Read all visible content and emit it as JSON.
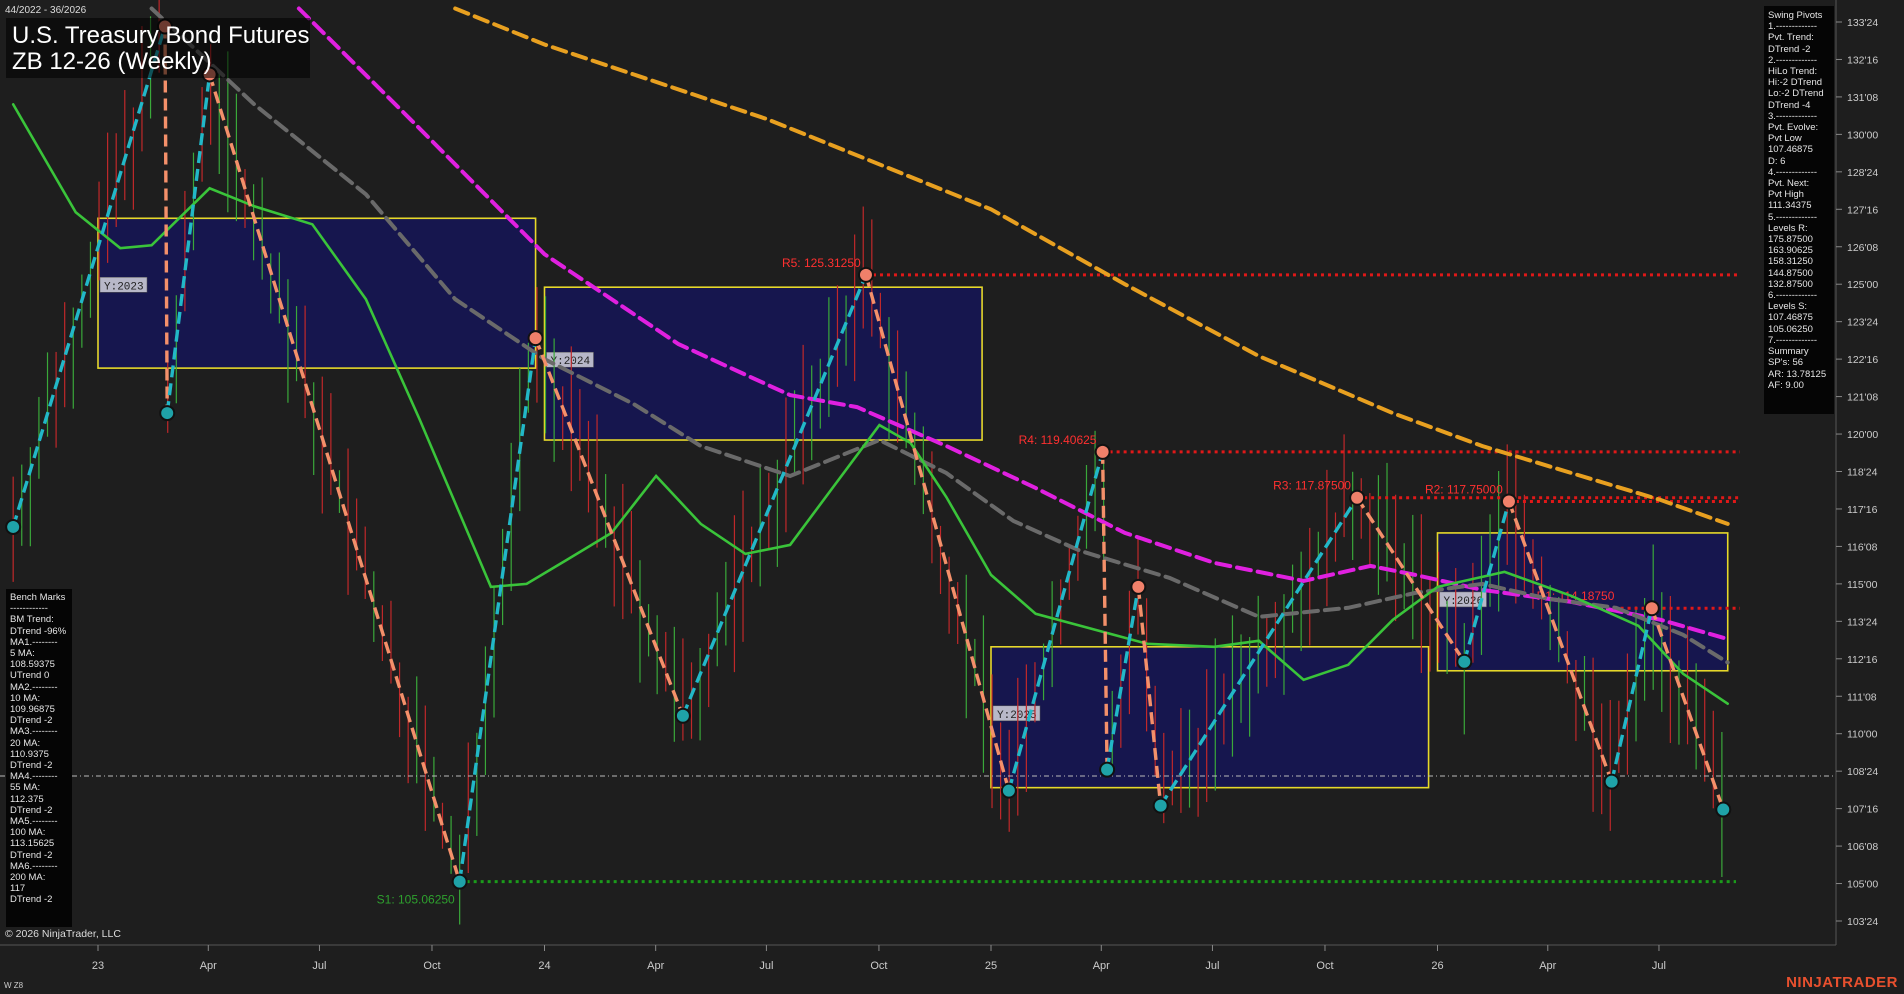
{
  "header": {
    "date_range": "44/2022 - 36/2026",
    "title": "U.S. Treasury Bond Futures",
    "subtitle": "ZB 12-26 (Weekly)"
  },
  "swing_pivots": [
    "Swing Pivots",
    "1.-------------",
    "Pvt. Trend:",
    "DTrend -2",
    "2.-------------",
    "HiLo Trend:",
    "Hi:-2 DTrend",
    "Lo:-2 DTrend",
    "DTrend -4",
    "3.-------------",
    "Pvt. Evolve:",
    "Pvt Low",
    "107.46875",
    "D: 6",
    "4.-------------",
    "Pvt. Next:",
    "Pvt High",
    "111.34375",
    "5.-------------",
    "Levels R:",
    "175.87500",
    "163.90625",
    "158.31250",
    "144.87500",
    "132.87500",
    "6.-------------",
    "Levels S:",
    "107.46875",
    "105.06250",
    "7.-------------",
    "Summary",
    "SP's: 56",
    "AR: 13.78125",
    "AF: 9.00"
  ],
  "bench_marks": [
    "Bench Marks",
    "------------",
    "BM Trend:",
    "DTrend -96%",
    "MA1.--------",
    "5 MA:",
    "108.59375",
    "UTrend 0",
    "MA2.--------",
    "10 MA:",
    "109.96875",
    "DTrend -2",
    "MA3.--------",
    "20 MA:",
    "110.9375",
    "DTrend -2",
    "MA4.--------",
    "55 MA:",
    "112.375",
    "DTrend -2",
    "MA5.--------",
    "100 MA:",
    "113.15625",
    "DTrend -2",
    "MA6.--------",
    "200 MA:",
    "117",
    "DTrend -2"
  ],
  "footer": {
    "copyright": "© 2026 NinjaTrader, LLC",
    "instrument": "W Z8",
    "brand": "NINJATRADER"
  },
  "chart_data": {
    "type": "line",
    "ylim": [
      102.5,
      134.0
    ],
    "grid": false,
    "yticks": [
      "133'24",
      "132'16",
      "131'08",
      "130'00",
      "128'24",
      "127'16",
      "126'08",
      "125'00",
      "123'24",
      "122'16",
      "121'08",
      "120'00",
      "118'24",
      "117'16",
      "116'08",
      "115'00",
      "113'24",
      "112'16",
      "111'08",
      "110'00",
      "108'24",
      "107'16",
      "106'08",
      "105'00",
      "103'24"
    ],
    "ytick_values": [
      133.75,
      132.5,
      131.25,
      130.0,
      128.75,
      127.5,
      126.25,
      125.0,
      123.75,
      122.5,
      121.25,
      120.0,
      118.75,
      117.5,
      116.25,
      115.0,
      113.75,
      112.5,
      111.25,
      110.0,
      108.75,
      107.5,
      106.25,
      105.0,
      103.75
    ],
    "xticks": [
      {
        "label": "23",
        "t": 0.0
      },
      {
        "label": "Apr",
        "t": 0.247
      },
      {
        "label": "Jul",
        "t": 0.496
      },
      {
        "label": "Oct",
        "t": 0.748
      },
      {
        "label": "24",
        "t": 1.0
      },
      {
        "label": "Apr",
        "t": 1.249
      },
      {
        "label": "Jul",
        "t": 1.497
      },
      {
        "label": "Oct",
        "t": 1.749
      },
      {
        "label": "25",
        "t": 2.0
      },
      {
        "label": "Apr",
        "t": 2.247
      },
      {
        "label": "Jul",
        "t": 2.496
      },
      {
        "label": "Oct",
        "t": 2.748
      },
      {
        "label": "26",
        "t": 3.0
      },
      {
        "label": "Apr",
        "t": 3.247
      },
      {
        "label": "Jul",
        "t": 3.496
      }
    ],
    "x_unit": "years since 2023 start",
    "resistance_levels": [
      {
        "label": "R5: 125.31250",
        "value": 125.3125,
        "start": 1.72
      },
      {
        "label": "R4: 119.40625",
        "value": 119.40625,
        "start": 2.25
      },
      {
        "label": "R3: 117.87500",
        "value": 117.875,
        "start": 2.82
      },
      {
        "label": "R2: 117.75000",
        "value": 117.75,
        "start": 3.16
      },
      {
        "label": "R1: 114.18750",
        "value": 114.1875,
        "start": 3.41
      }
    ],
    "support_levels": [
      {
        "label": "S1: 105.06250",
        "value": 105.0625,
        "start": 0.81
      }
    ],
    "year_boxes": [
      {
        "label": "Y:2023",
        "x0": 0.0,
        "x1": 0.98,
        "y0": 122.2,
        "y1": 127.2
      },
      {
        "label": "Y:2024",
        "x0": 1.0,
        "x1": 1.98,
        "y0": 119.8,
        "y1": 124.9
      },
      {
        "label": "Y:2025",
        "x0": 2.0,
        "x1": 2.98,
        "y0": 108.2,
        "y1": 112.9
      },
      {
        "label": "Y:2026",
        "x0": 3.0,
        "x1": 3.65,
        "y0": 112.1,
        "y1": 116.7
      }
    ],
    "swing_pivots": [
      {
        "t": -0.19,
        "v": 116.9,
        "type": "low"
      },
      {
        "t": 0.15,
        "v": 133.6,
        "type": "high"
      },
      {
        "t": 0.155,
        "v": 120.7,
        "type": "low"
      },
      {
        "t": 0.25,
        "v": 132.0,
        "type": "high"
      },
      {
        "t": 0.81,
        "v": 105.0625,
        "type": "low"
      },
      {
        "t": 0.98,
        "v": 123.2,
        "type": "high"
      },
      {
        "t": 1.31,
        "v": 110.6,
        "type": "low"
      },
      {
        "t": 1.72,
        "v": 125.3125,
        "type": "high"
      },
      {
        "t": 2.04,
        "v": 108.1,
        "type": "low"
      },
      {
        "t": 2.25,
        "v": 119.40625,
        "type": "high"
      },
      {
        "t": 2.26,
        "v": 108.8,
        "type": "low"
      },
      {
        "t": 2.33,
        "v": 114.9,
        "type": "high"
      },
      {
        "t": 2.38,
        "v": 107.6,
        "type": "low"
      },
      {
        "t": 2.82,
        "v": 117.875,
        "type": "high"
      },
      {
        "t": 3.06,
        "v": 112.4,
        "type": "low"
      },
      {
        "t": 3.16,
        "v": 117.75,
        "type": "high"
      },
      {
        "t": 3.39,
        "v": 108.4,
        "type": "low"
      },
      {
        "t": 3.48,
        "v": 114.1875,
        "type": "high"
      },
      {
        "t": 3.64,
        "v": 107.46875,
        "type": "low"
      }
    ],
    "series": [
      {
        "name": "200 MA",
        "color": "#e8a020",
        "points": [
          [
            0.8,
            134.2
          ],
          [
            1.0,
            133.0
          ],
          [
            1.5,
            130.5
          ],
          [
            2.0,
            127.5
          ],
          [
            2.3,
            125.0
          ],
          [
            2.6,
            122.6
          ],
          [
            2.9,
            120.7
          ],
          [
            3.1,
            119.6
          ],
          [
            3.3,
            118.7
          ],
          [
            3.5,
            117.8
          ],
          [
            3.65,
            117.0
          ]
        ]
      },
      {
        "name": "100 MA",
        "color": "#e020e0",
        "points": [
          [
            0.45,
            134.2
          ],
          [
            0.7,
            130.5
          ],
          [
            1.0,
            126.0
          ],
          [
            1.3,
            123.0
          ],
          [
            1.55,
            121.3
          ],
          [
            1.7,
            120.9
          ],
          [
            1.9,
            119.6
          ],
          [
            2.1,
            118.2
          ],
          [
            2.3,
            116.7
          ],
          [
            2.5,
            115.7
          ],
          [
            2.7,
            115.1
          ],
          [
            2.85,
            115.6
          ],
          [
            2.95,
            115.3
          ],
          [
            3.1,
            114.8
          ],
          [
            3.3,
            114.4
          ],
          [
            3.5,
            113.8
          ],
          [
            3.65,
            113.15625
          ]
        ]
      },
      {
        "name": "55 MA",
        "color": "#6a6a6a",
        "points": [
          [
            0.12,
            134.2
          ],
          [
            0.35,
            131.0
          ],
          [
            0.6,
            128.0
          ],
          [
            0.8,
            124.5
          ],
          [
            1.0,
            122.5
          ],
          [
            1.2,
            121.0
          ],
          [
            1.35,
            119.6
          ],
          [
            1.55,
            118.6
          ],
          [
            1.75,
            119.8
          ],
          [
            1.9,
            118.7
          ],
          [
            2.05,
            117.1
          ],
          [
            2.2,
            116.1
          ],
          [
            2.4,
            115.2
          ],
          [
            2.6,
            113.9
          ],
          [
            2.8,
            114.2
          ],
          [
            2.95,
            114.7
          ],
          [
            3.1,
            115.0
          ],
          [
            3.25,
            114.5
          ],
          [
            3.4,
            114.2
          ],
          [
            3.55,
            113.3
          ],
          [
            3.65,
            112.375
          ]
        ]
      },
      {
        "name": "20 MA",
        "color": "#3ac43a",
        "points": [
          [
            -0.19,
            131.0
          ],
          [
            -0.05,
            127.4
          ],
          [
            0.05,
            126.2
          ],
          [
            0.12,
            126.3
          ],
          [
            0.25,
            128.2
          ],
          [
            0.35,
            127.6
          ],
          [
            0.48,
            127.0
          ],
          [
            0.6,
            124.5
          ],
          [
            0.72,
            120.5
          ],
          [
            0.88,
            114.9
          ],
          [
            0.96,
            115.0
          ],
          [
            1.05,
            115.8
          ],
          [
            1.15,
            116.7
          ],
          [
            1.25,
            118.6
          ],
          [
            1.35,
            117.0
          ],
          [
            1.45,
            116.0
          ],
          [
            1.55,
            116.3
          ],
          [
            1.65,
            118.3
          ],
          [
            1.75,
            120.3
          ],
          [
            1.82,
            119.7
          ],
          [
            1.9,
            117.9
          ],
          [
            2.0,
            115.3
          ],
          [
            2.1,
            114.0
          ],
          [
            2.2,
            113.6
          ],
          [
            2.35,
            113.0
          ],
          [
            2.5,
            112.9
          ],
          [
            2.6,
            113.1
          ],
          [
            2.7,
            111.8
          ],
          [
            2.8,
            112.3
          ],
          [
            2.9,
            113.8
          ],
          [
            3.0,
            114.9
          ],
          [
            3.15,
            115.4
          ],
          [
            3.3,
            114.6
          ],
          [
            3.45,
            113.6
          ],
          [
            3.55,
            112.0
          ],
          [
            3.65,
            111.0
          ]
        ]
      }
    ],
    "legend": "none"
  }
}
